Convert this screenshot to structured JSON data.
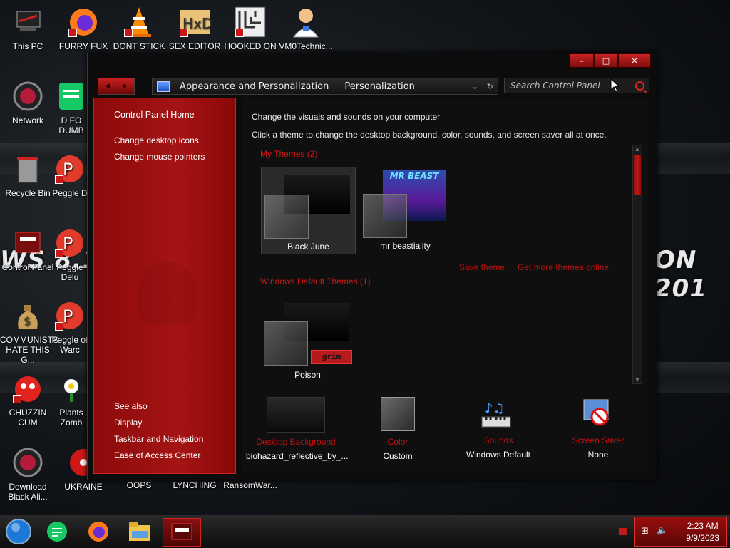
{
  "desktop": {
    "icons": [
      {
        "label": "This PC"
      },
      {
        "label": "FURRY FUX"
      },
      {
        "label": "DONT STICK"
      },
      {
        "label": "SEX EDITOR"
      },
      {
        "label": "HOOKED ON"
      },
      {
        "label": "VM0Technic..."
      },
      {
        "label": "Network"
      },
      {
        "label": "D FO DUMB"
      },
      {
        "label": "Recycle Bin"
      },
      {
        "label": "Peggle D"
      },
      {
        "label": "Control Panel"
      },
      {
        "label": "Peggle Delu"
      },
      {
        "label": "COMMUNISTS HATE THIS G..."
      },
      {
        "label": "Peggle of Warc"
      },
      {
        "label": "CHUZZIN CUM"
      },
      {
        "label": "Plants Zomb"
      },
      {
        "label": "Download Black Ali..."
      },
      {
        "label": "UKRAINE"
      },
      {
        "label": "OOPS"
      },
      {
        "label": "LYNCHING"
      },
      {
        "label": "RansomWar..."
      }
    ],
    "wallpaper_text_left": "WS 8.1",
    "wallpaper_text_right": "ON 201"
  },
  "window": {
    "caption_buttons": {
      "minimize": "–",
      "maximize": "□",
      "close": "✕"
    },
    "address": {
      "crumbs": [
        "Appearance and Personalization",
        "Personalization"
      ],
      "dropdown_glyph": "⌄",
      "refresh_glyph": "↻"
    },
    "search": {
      "placeholder": "Search Control Panel"
    },
    "sidebar": {
      "home": "Control Panel Home",
      "links": [
        "Change desktop icons",
        "Change mouse pointers"
      ],
      "see_also_title": "See also",
      "see_also": [
        "Display",
        "Taskbar and Navigation",
        "Ease of Access Center"
      ]
    },
    "main": {
      "heading": "Change the visuals and sounds on your computer",
      "subheading": "Click a theme to change the desktop background, color, sounds, and screen saver all at once.",
      "my_themes_title": "My Themes (2)",
      "my_themes": [
        {
          "name": "Black June",
          "selected": true
        },
        {
          "name": "mr beastiality",
          "selected": false,
          "thumbnail_text": "MR BEAST"
        }
      ],
      "save_theme": "Save theme",
      "get_more": "Get more themes online",
      "default_themes_title": "Windows Default Themes (1)",
      "default_themes": [
        {
          "name": "Poison",
          "badge_text": "grim"
        }
      ]
    },
    "bottom_bar": [
      {
        "title": "Desktop Background",
        "value": "biohazard_reflective_by_...",
        "icon": "wallpaper-thumb"
      },
      {
        "title": "Color",
        "value": "Custom",
        "icon": "color-swatch"
      },
      {
        "title": "Sounds",
        "value": "Windows Default",
        "icon": "music-notes-keyboard"
      },
      {
        "title": "Screen Saver",
        "value": "None",
        "icon": "screensaver-no"
      }
    ]
  },
  "taskbar": {
    "items": [
      "start-orb",
      "notes-app",
      "firefox",
      "file-explorer",
      "control-panel-active"
    ],
    "clock": {
      "time": "2:23 AM",
      "date": "9/9/2023"
    }
  },
  "colors": {
    "accent": "#b81414",
    "link_red": "#c01010",
    "background": "#0f0f0f"
  }
}
